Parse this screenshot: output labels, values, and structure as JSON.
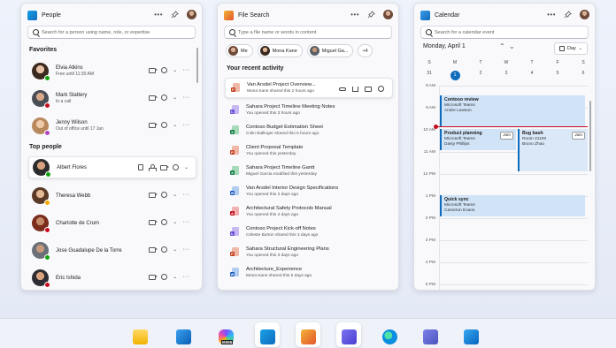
{
  "colors": {
    "accent": "#0f6cbd",
    "available": "#13a10e",
    "busy": "#c50f1f",
    "away": "#f7a600",
    "ooo": "#b146c2"
  },
  "people": {
    "app_title": "People",
    "search_placeholder": "Search for a person using name, role, or expertise",
    "favorites_label": "Favorites",
    "top_people_label": "Top people",
    "favorites": [
      {
        "name": "Elvia Atkins",
        "status": "Free until 11:30 AM",
        "presence": "available"
      },
      {
        "name": "Mark Slattery",
        "status": "In a call",
        "presence": "busy"
      },
      {
        "name": "Jenny Wilson",
        "status": "Out of office until 17 Jan",
        "presence": "ooo"
      }
    ],
    "top_people": [
      {
        "name": "Albert Flores",
        "presence": "available"
      },
      {
        "name": "Theresa Webb",
        "presence": "away"
      },
      {
        "name": "Charlotte de Crum",
        "presence": "busy"
      },
      {
        "name": "Jose Guadalupe De la Torre",
        "presence": "available"
      },
      {
        "name": "Eric Ishida",
        "presence": "busy"
      }
    ]
  },
  "files": {
    "app_title": "File Search",
    "search_placeholder": "Type a file name or words in content",
    "chips": [
      "Me",
      "Mona Kane",
      "Miguel Ga...",
      "+4"
    ],
    "recent_label": "Your recent activity",
    "items": [
      {
        "name": "Van Arsdel Project Overview...",
        "sub": "Mona Kane shared this 2 hours ago",
        "type": "ppt"
      },
      {
        "name": "Sahara Project Timeline Meeting Notes",
        "sub": "You opened this 3 hours ago",
        "type": "loop"
      },
      {
        "name": "Contoso Budget Estimation Sheet",
        "sub": "Colin Ballinger shared this 5 hours ago",
        "type": "xls"
      },
      {
        "name": "Client Proposal Template",
        "sub": "You opened this yesterday",
        "type": "ppt"
      },
      {
        "name": "Sahara Project Timeline Gantt",
        "sub": "Miguel Garcia modified this yesterday",
        "type": "xls"
      },
      {
        "name": "Van Arsdel Interior Design Specifications",
        "sub": "You opened this 2 days ago",
        "type": "doc"
      },
      {
        "name": "Architectural Safety Protocols Manual",
        "sub": "You opened this 2 days ago",
        "type": "pdf"
      },
      {
        "name": "Contoso Project Kick-off  Notes",
        "sub": "Celeste Burton shared this 3 days ago",
        "type": "loop"
      },
      {
        "name": "Sahara Structural Engineering Plans",
        "sub": "You opened this 3 days ago",
        "type": "ppt"
      },
      {
        "name": "Architecture_Experience",
        "sub": "Mona Kane shared this 5 days ago",
        "type": "doc"
      }
    ]
  },
  "calendar": {
    "app_title": "Calendar",
    "search_placeholder": "Search for a calendar event",
    "date_label": "Monday, April 1",
    "view_label": "Day",
    "weekdays": [
      "S",
      "M",
      "T",
      "W",
      "T",
      "F",
      "S"
    ],
    "dates": [
      "31",
      "1",
      "2",
      "3",
      "4",
      "5",
      "6"
    ],
    "hours": [
      "8 AM",
      "9 AM",
      "10 AM",
      "11 AM",
      "12 PM",
      "1 PM",
      "2 PM",
      "3 PM",
      "4 PM",
      "5 PM"
    ],
    "events": [
      {
        "title": "Contoso review",
        "loc": "Microsoft Teams",
        "who": "Andre Lawson",
        "join": ""
      },
      {
        "title": "Product planning",
        "loc": "Microsoft Teams",
        "who": "Daisy Phillips",
        "join": "Join"
      },
      {
        "title": "Bug bash",
        "loc": "Room 21100",
        "who": "Bruno Zhao",
        "join": "Join"
      },
      {
        "title": "Quick sync",
        "loc": "Microsoft Teams",
        "who": "Cameron Evans",
        "join": ""
      }
    ]
  },
  "taskbar": {
    "items": [
      "file-explorer-icon",
      "microsoft-store-icon",
      "copilot-m365-icon",
      "people-app-icon",
      "file-search-app-icon",
      "calendar-app-icon",
      "edge-icon",
      "teams-icon",
      "outlook-icon"
    ],
    "badge": "M365"
  }
}
